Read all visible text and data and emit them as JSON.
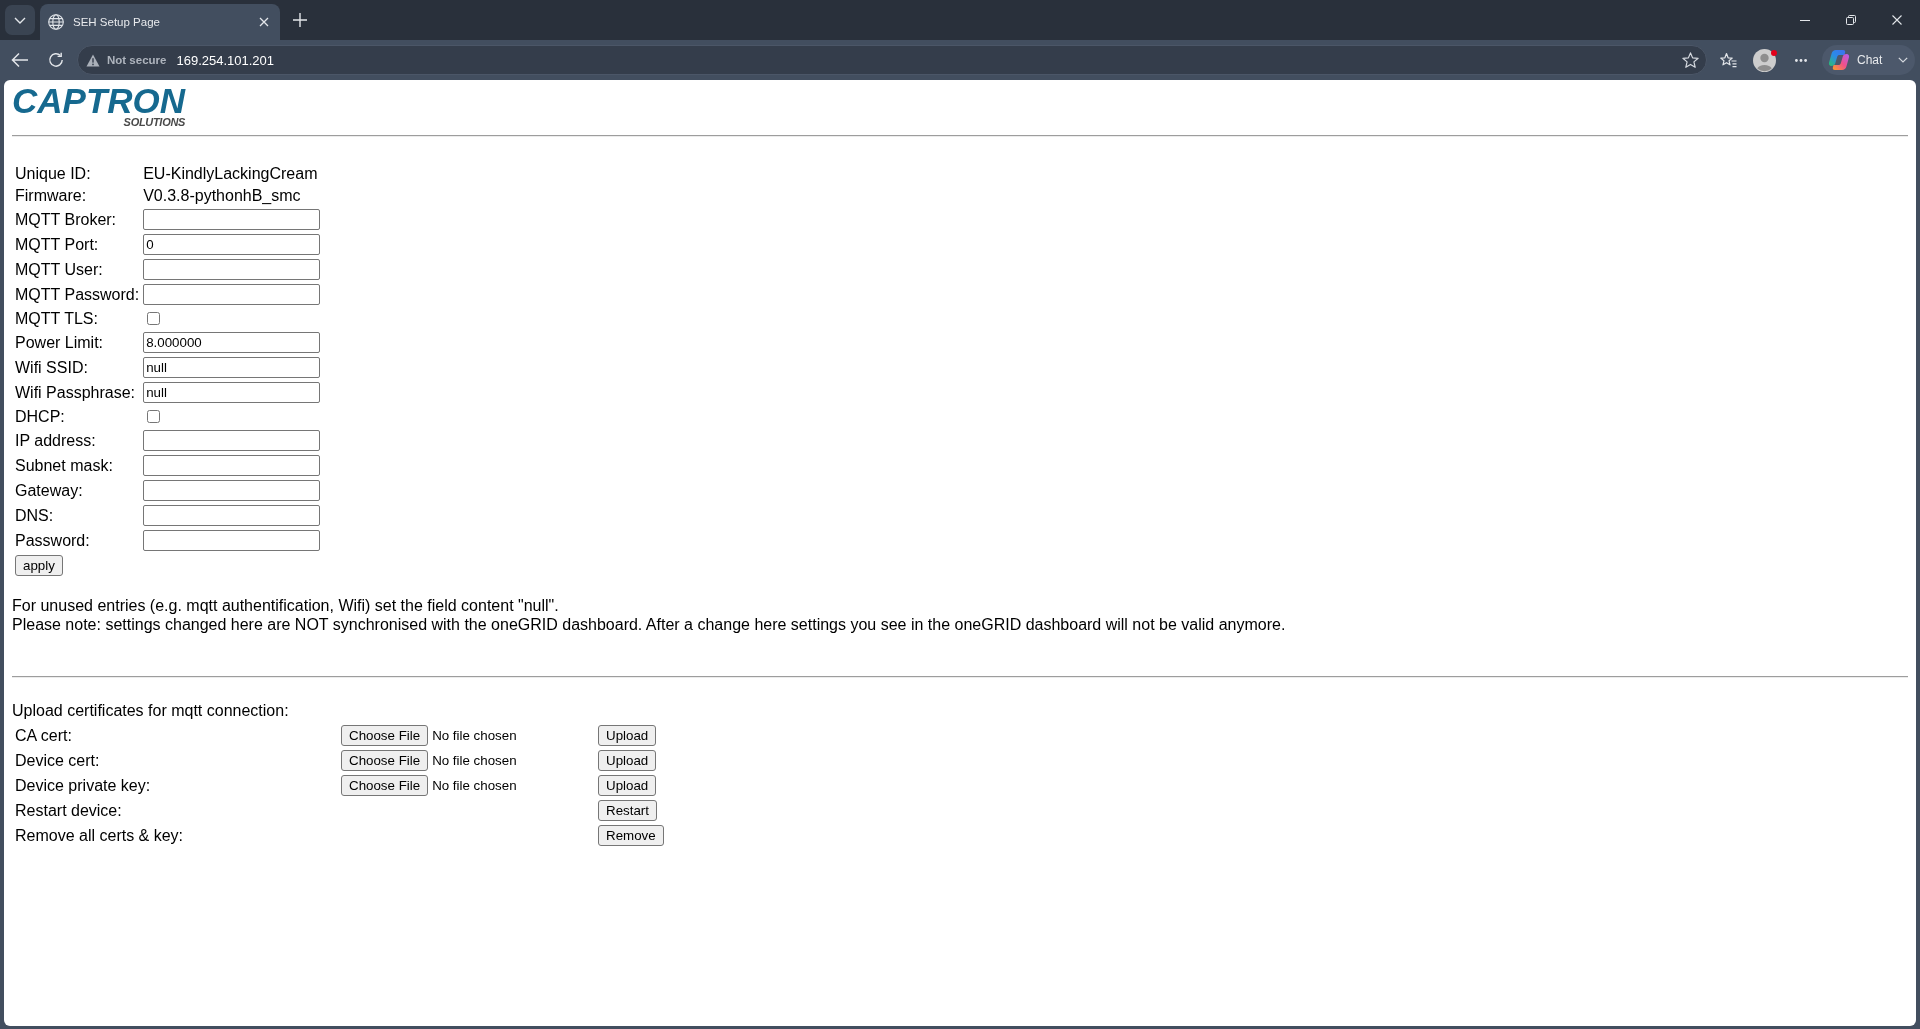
{
  "browser": {
    "tabs": [
      {
        "title": "SEH Setup Page",
        "selected": true
      }
    ],
    "address_bar": {
      "security_label": "Not secure",
      "url": "169.254.101.201"
    },
    "profile": {
      "notification": true
    },
    "chat_button": {
      "label": "Chat"
    }
  },
  "page": {
    "logo": {
      "wordmark": "CAPTRON",
      "tagline": "SOLUTIONS"
    },
    "settings": {
      "rows": [
        {
          "kind": "info",
          "label": "Unique ID:",
          "value": "EU-KindlyLackingCream"
        },
        {
          "kind": "info",
          "label": "Firmware:",
          "value": "V0.3.8-pythonhB_smc"
        },
        {
          "kind": "text",
          "label": "MQTT Broker:"
        },
        {
          "kind": "text",
          "label": "MQTT Port:",
          "value": "0"
        },
        {
          "kind": "text",
          "label": "MQTT User:"
        },
        {
          "kind": "text",
          "label": "MQTT Password:"
        },
        {
          "kind": "checkbox",
          "label": "MQTT TLS:",
          "checked": false
        },
        {
          "kind": "text",
          "label": "Power Limit:",
          "value": "8.000000"
        },
        {
          "kind": "text",
          "label": "Wifi SSID:",
          "value": "null"
        },
        {
          "kind": "text",
          "label": "Wifi Passphrase:",
          "value": "null"
        },
        {
          "kind": "checkbox",
          "label": "DHCP:",
          "checked": false
        },
        {
          "kind": "text",
          "label": "IP address:"
        },
        {
          "kind": "text",
          "label": "Subnet mask:"
        },
        {
          "kind": "text",
          "label": "Gateway:"
        },
        {
          "kind": "text",
          "label": "DNS:"
        },
        {
          "kind": "text",
          "label": "Password:"
        }
      ],
      "submit_button": "apply"
    },
    "notes": [
      "For unused entries (e.g. mqtt authentification, Wifi) set the field content \"null\".",
      "Please note: settings changed here are NOT synchronised with the oneGRID dashboard. After a change here settings you see in the oneGRID dashboard will not be valid anymore."
    ],
    "certificates": {
      "title": "Upload certificates for mqtt connection:",
      "rows": [
        {
          "kind": "file",
          "label": "CA cert:",
          "choose_label": "Choose File",
          "file_status": "No file chosen",
          "button": "Upload"
        },
        {
          "kind": "file",
          "label": "Device cert:",
          "choose_label": "Choose File",
          "file_status": "No file chosen",
          "button": "Upload"
        },
        {
          "kind": "file",
          "label": "Device private key:",
          "choose_label": "Choose File",
          "file_status": "No file chosen",
          "button": "Upload"
        },
        {
          "kind": "action",
          "label": "Restart device:",
          "button": "Restart"
        },
        {
          "kind": "action",
          "label": "Remove all certs & key:",
          "button": "Remove"
        }
      ]
    }
  }
}
